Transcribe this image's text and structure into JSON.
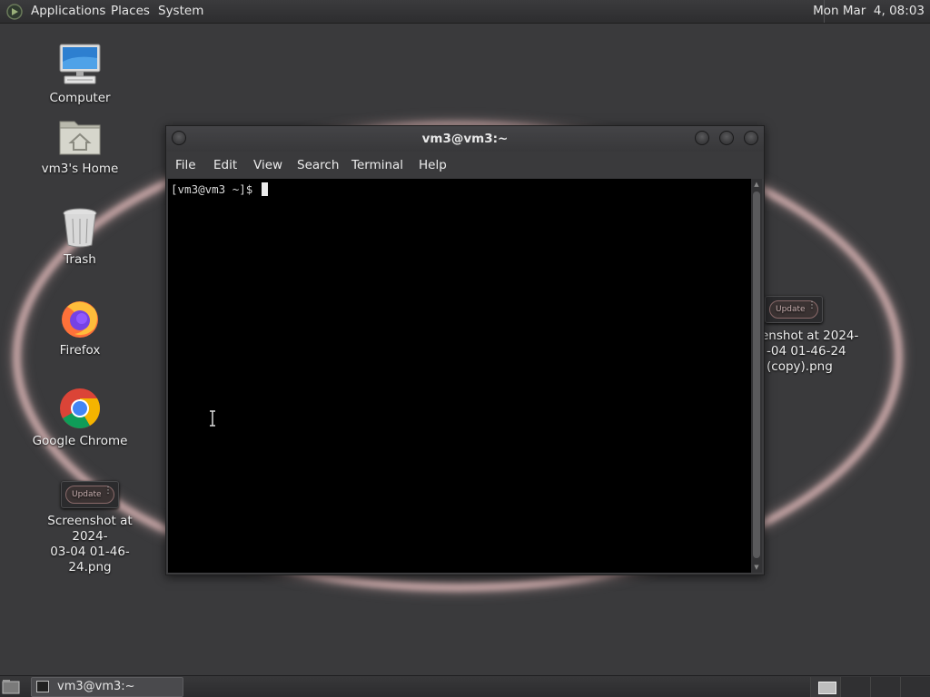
{
  "top_panel": {
    "menus": [
      "Applications",
      "Places",
      "System"
    ],
    "clock": "Mon Mar  4, 08:03"
  },
  "desktop_icons": [
    {
      "label": "Computer",
      "icon": "computer-icon"
    },
    {
      "label": "vm3's Home",
      "icon": "home-folder-icon"
    },
    {
      "label": "Trash",
      "icon": "trash-icon"
    },
    {
      "label": "Firefox",
      "icon": "firefox-icon"
    },
    {
      "label": "Google Chrome",
      "icon": "chrome-icon"
    },
    {
      "label_line1": "Screenshot at 2024-",
      "label_line2": "03-04 01-46-24.png",
      "icon": "image-thumbnail-icon",
      "chip": "Update"
    }
  ],
  "right_file": {
    "line1": "enshot at 2024-",
    "line2": "-04 01-46-24",
    "line3": "(copy).png",
    "chip": "Update"
  },
  "terminal": {
    "title": "vm3@vm3:~",
    "menu": [
      "File",
      "Edit",
      "View",
      "Search",
      "Terminal",
      "Help"
    ],
    "prompt": "[vm3@vm3 ~]$ "
  },
  "bottom_panel": {
    "task_label": "vm3@vm3:~"
  },
  "colors": {
    "panel": "#2d2d2f",
    "desktop": "#3a3a3c",
    "terminal_bg": "#000000",
    "ring": "#e6bebe"
  }
}
